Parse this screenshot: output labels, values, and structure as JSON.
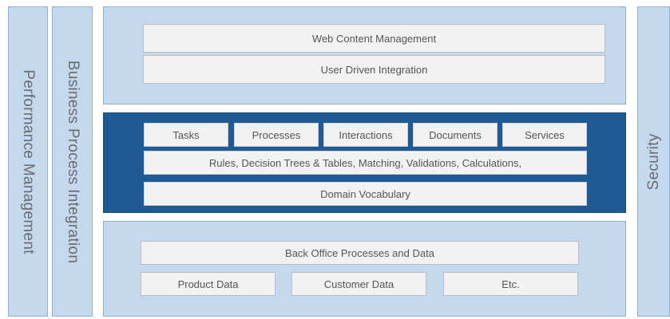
{
  "sidebars": {
    "performance": "Performance Management",
    "business": "Business Process Integration",
    "security": "Security"
  },
  "top_layer": {
    "items": [
      "Web Content Management",
      "User Driven Integration"
    ]
  },
  "middle_layer": {
    "row1": [
      "Tasks",
      "Processes",
      "Interactions",
      "Documents",
      "Services"
    ],
    "rules": "Rules, Decision Trees & Tables, Matching,  Validations, Calculations,",
    "vocabulary": "Domain Vocabulary"
  },
  "bottom_layer": {
    "main": "Back Office Processes and Data",
    "row": [
      "Product Data",
      "Customer Data",
      "Etc."
    ]
  },
  "colors": {
    "light_panel": "#c5d9ee",
    "dark_panel": "#1f5a96",
    "box": "#f2f2f2"
  }
}
